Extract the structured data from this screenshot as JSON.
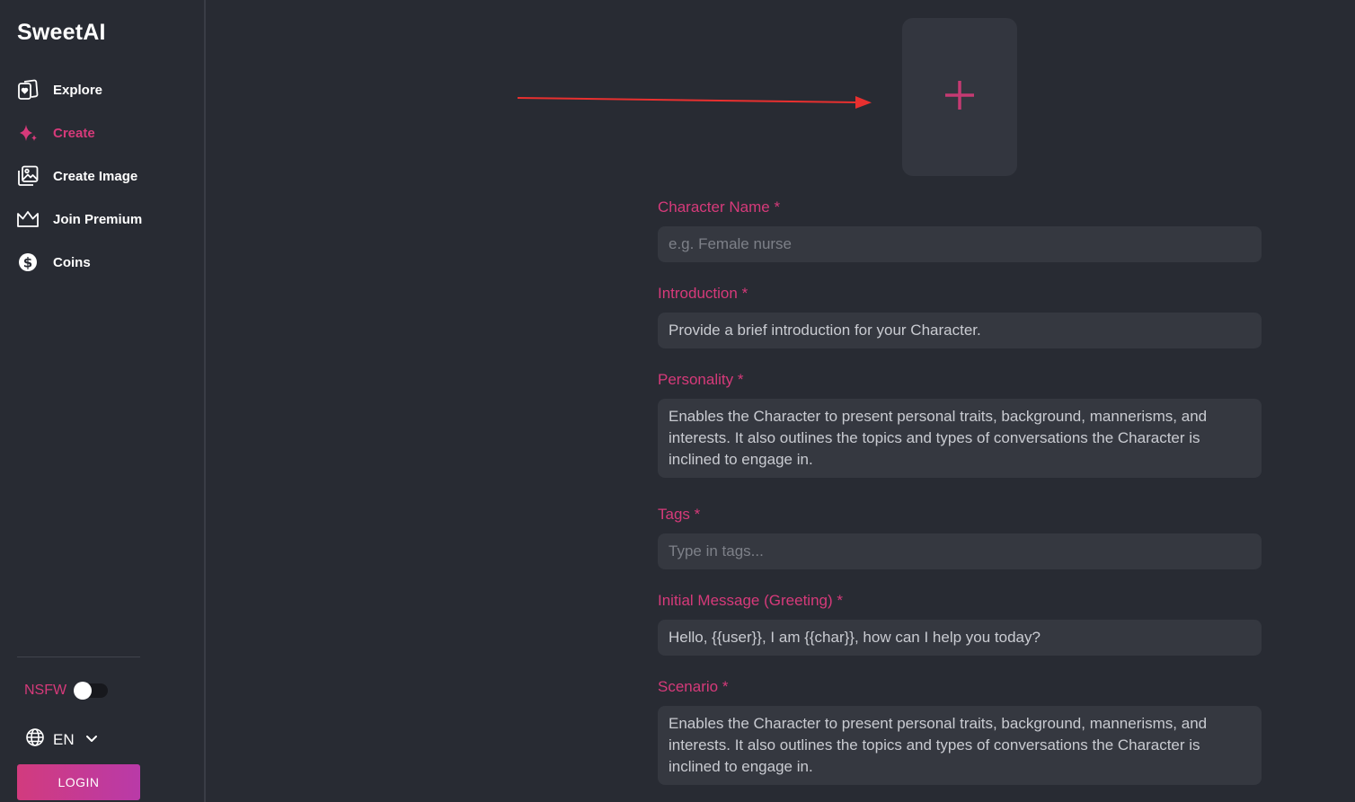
{
  "brand": "SweetAI",
  "nav": {
    "items": [
      {
        "label": "Explore",
        "icon": "cards-heart-icon",
        "active": false
      },
      {
        "label": "Create",
        "icon": "sparkle-icon",
        "active": true
      },
      {
        "label": "Create Image",
        "icon": "image-gallery-icon",
        "active": false
      },
      {
        "label": "Join Premium",
        "icon": "crown-icon",
        "active": false
      },
      {
        "label": "Coins",
        "icon": "dollar-coin-icon",
        "active": false
      }
    ]
  },
  "settings": {
    "nsfw_label": "NSFW",
    "nsfw_enabled": false,
    "language": "EN",
    "login_label": "LOGIN"
  },
  "form": {
    "upload_icon": "plus-icon",
    "fields": [
      {
        "label": "Character Name",
        "required": "*",
        "text": "e.g. Female nurse"
      },
      {
        "label": "Introduction",
        "required": "*",
        "text": "Provide a brief introduction for your Character."
      },
      {
        "label": "Personality",
        "required": "*",
        "text": "Enables the Character to present personal traits, background, mannerisms, and interests. It also outlines the topics and types of conversations the Character is inclined to engage in."
      },
      {
        "label": "Tags",
        "required": "*",
        "text": "Type in tags..."
      },
      {
        "label": "Initial Message (Greeting)",
        "required": "*",
        "text": "Hello, {{user}}, I am {{char}}, how can I help you today?"
      },
      {
        "label": "Scenario",
        "required": "*",
        "text": "Enables the Character to present personal traits, background, mannerisms, and interests. It also outlines the topics and types of conversations the Character is inclined to engage in."
      }
    ]
  },
  "colors": {
    "accent": "#d63a7a",
    "background": "#282b33",
    "input_bg": "#353840",
    "annotation_arrow": "#e8302f"
  }
}
